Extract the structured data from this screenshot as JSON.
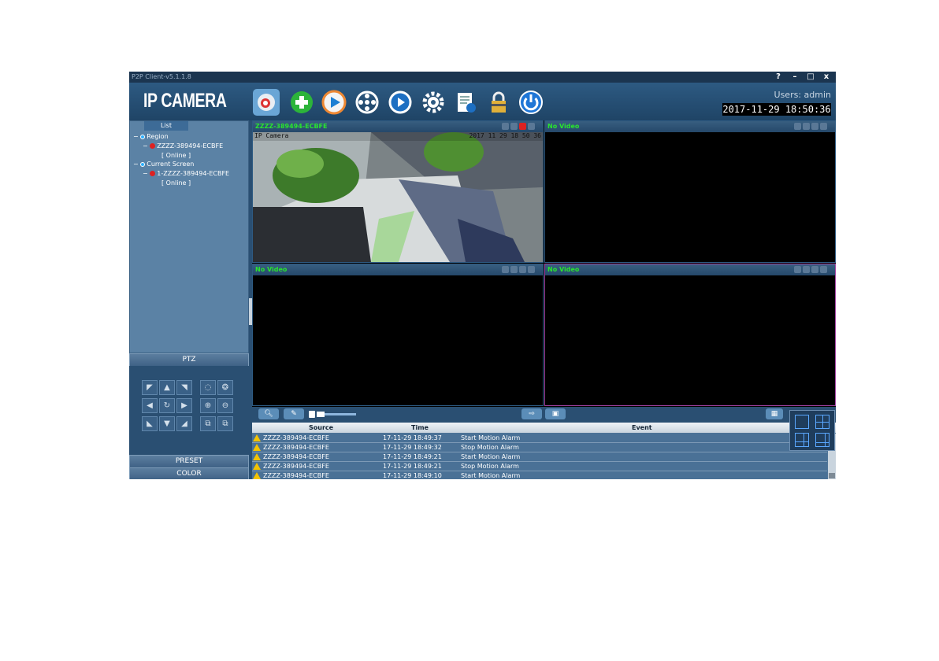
{
  "window": {
    "title": "P2P Client-v5.1.1.8",
    "controls": [
      "?",
      "–",
      "□",
      "x"
    ]
  },
  "header": {
    "logo": "IP CAMERA",
    "tools": [
      "camera-icon",
      "add-icon",
      "play-icon",
      "film-reel-icon",
      "playback-icon",
      "gear-icon",
      "log-report-icon",
      "lock-icon",
      "power-icon"
    ],
    "user": "Users: admin",
    "clock": "2017-11-29 18:50:36"
  },
  "sidebar": {
    "list_tab": "List",
    "tree": [
      {
        "level": 0,
        "label": "Region",
        "type": "group"
      },
      {
        "level": 1,
        "label": "ZZZZ-389494-ECBFE",
        "type": "camera"
      },
      {
        "level": 2,
        "label": "[ Online ]",
        "type": "status"
      },
      {
        "level": 0,
        "label": "Current Screen",
        "type": "group"
      },
      {
        "level": 1,
        "label": "1-ZZZZ-389494-ECBFE",
        "type": "camera"
      },
      {
        "level": 2,
        "label": "[ Online ]",
        "type": "status"
      }
    ],
    "ptz_label": "PTZ",
    "preset_label": "PRESET",
    "color_label": "COLOR"
  },
  "video": {
    "panes": [
      {
        "title": "ZZZZ-389494-ECBFE",
        "overlay_left": "IP Camera",
        "overlay_right": "2017 11 29 18 50 36",
        "has_video": true
      },
      {
        "title": "No Video",
        "has_video": false
      },
      {
        "title": "No Video",
        "has_video": false
      },
      {
        "title": "No Video",
        "has_video": false
      }
    ]
  },
  "log": {
    "columns": [
      "Source",
      "Time",
      "Event"
    ],
    "rows": [
      {
        "source": "ZZZZ-389494-ECBFE",
        "time": "17-11-29 18:49:37",
        "event": "Start Motion Alarm"
      },
      {
        "source": "ZZZZ-389494-ECBFE",
        "time": "17-11-29 18:49:32",
        "event": "Stop Motion Alarm"
      },
      {
        "source": "ZZZZ-389494-ECBFE",
        "time": "17-11-29 18:49:21",
        "event": "Start Motion Alarm"
      },
      {
        "source": "ZZZZ-389494-ECBFE",
        "time": "17-11-29 18:49:21",
        "event": "Stop Motion Alarm"
      },
      {
        "source": "ZZZZ-389494-ECBFE",
        "time": "17-11-29 18:49:10",
        "event": "Start Motion Alarm"
      }
    ]
  },
  "colors": {
    "accent": "#2a4f72",
    "online_green": "#29e52f",
    "selected_border": "#a040a0"
  }
}
